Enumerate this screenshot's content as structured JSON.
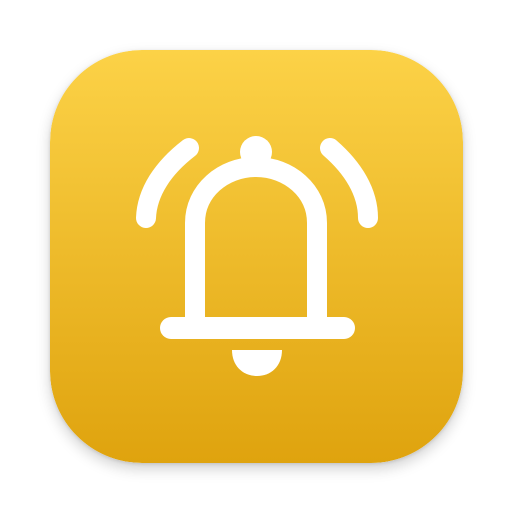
{
  "app_icon": {
    "name": "bell-alert-app-icon",
    "glyph": "ringing-bell-icon",
    "colors": {
      "gradient_top": "#FCD247",
      "gradient_bottom": "#DFA30E",
      "glyph": "#FFFFFF"
    }
  }
}
